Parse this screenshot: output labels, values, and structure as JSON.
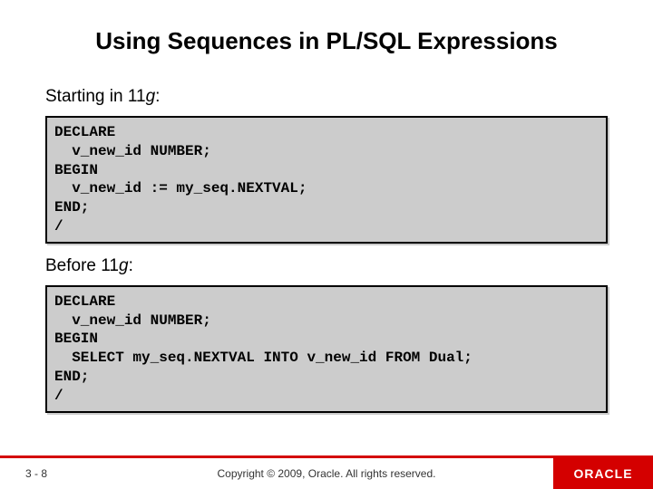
{
  "title": "Using Sequences in PL/SQL Expressions",
  "section1": {
    "label_prefix": "Starting in 11",
    "label_italic": "g",
    "label_suffix": ":",
    "code": "DECLARE\n  v_new_id NUMBER;\nBEGIN\n  v_new_id := my_seq.NEXTVAL;\nEND;\n/"
  },
  "section2": {
    "label_prefix": "Before 11",
    "label_italic": "g",
    "label_suffix": ":",
    "code": "DECLARE\n  v_new_id NUMBER;\nBEGIN\n  SELECT my_seq.NEXTVAL INTO v_new_id FROM Dual;\nEND;\n/"
  },
  "footer": {
    "pageno": "3 - 8",
    "copyright": "Copyright © 2009, Oracle. All rights reserved.",
    "logo_text": "ORACLE"
  }
}
